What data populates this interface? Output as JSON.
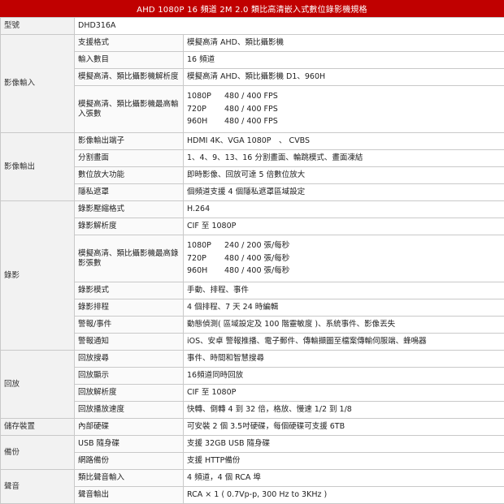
{
  "title": "AHD 1080P 16 頻道 2M 2.0 類比高清嵌入式數位錄影機規格",
  "rows": [
    {
      "cat": "型號",
      "label": "",
      "value": "DHD316A",
      "merged": true
    },
    {
      "cat": "影像輸入",
      "label": "支援格式",
      "value": "模擬高清 AHD、類比攝影機"
    },
    {
      "label": "輸入數目",
      "value": "16 頻道"
    },
    {
      "label": "模擬高清、類比攝影機解析度",
      "value": "模擬高清 AHD、類比攝影機 D1、960H"
    },
    {
      "label": "模擬高清、類比攝影機最高輸入張數",
      "fps": [
        [
          "1080P",
          "480 / 400 FPS"
        ],
        [
          "720P",
          "480 / 400 FPS"
        ],
        [
          "960H",
          "480 / 400 FPS"
        ]
      ]
    },
    {
      "cat": "影像輸出",
      "label": "影像輸出端子",
      "value": "HDMI 4K、VGA 1080P　、 CVBS"
    },
    {
      "label": "分割畫面",
      "value": "1、4、9、13、16 分割畫面、輪跳模式、畫面凍結"
    },
    {
      "label": "數位放大功能",
      "value": "即時影像、回放可達 5 倍數位放大"
    },
    {
      "label": "隱私遮罩",
      "value": "個頻道支援 4 個隱私遮罩區域設定"
    },
    {
      "cat": "錄影",
      "label": "錄影壓縮格式",
      "value": "H.264"
    },
    {
      "label": "錄影解析度",
      "value": "CIF 至 1080P"
    },
    {
      "label": "模擬高清、類比攝影機最高錄影張數",
      "fps": [
        [
          "1080P",
          "240 / 200 張/每秒"
        ],
        [
          "720P",
          "480 / 400 張/每秒"
        ],
        [
          "960H",
          "480 / 400 張/每秒"
        ]
      ]
    },
    {
      "label": "錄影模式",
      "value": "手動、排程、事件"
    },
    {
      "label": "錄影排程",
      "value": "4 個排程、7 天 24 時編輯"
    },
    {
      "label": "警報/事件",
      "value": "動態偵測( 區域設定及 100 階靈敏度 )、系統事件、影像丟失"
    },
    {
      "label": "警報通知",
      "value": "iOS、安卓 警報推播、電子郵件、傳輸擷圖至檔案傳輸伺服端、蜂鳴器"
    },
    {
      "cat": "回放",
      "label": "回放搜尋",
      "value": "事件、時間和智慧搜尋"
    },
    {
      "label": "回放顯示",
      "value": "16頻道同時回放"
    },
    {
      "label": "回放解析度",
      "value": "CIF 至 1080P"
    },
    {
      "label": "回放播放速度",
      "value": "快轉、倒轉 4 到 32 倍，格放、慢速 1/2 到 1/8"
    },
    {
      "cat": "儲存裝置",
      "label": "內部硬碟",
      "value": "可安裝 2 個 3.5吋硬碟，每個硬碟可支援 6TB"
    },
    {
      "cat": "備份",
      "label": "USB 隨身碟",
      "value": "支援 32GB USB 隨身碟"
    },
    {
      "label": "網路備份",
      "value": "支援 HTTP備份"
    },
    {
      "cat": "聲音",
      "label": "類比聲音輸入",
      "value": "4 頻道，4 個 RCA 埠"
    },
    {
      "label": "聲音輸出",
      "value": "RCA × 1 ( 0.7Vp-p, 300 Hz to 3KHz )"
    }
  ]
}
